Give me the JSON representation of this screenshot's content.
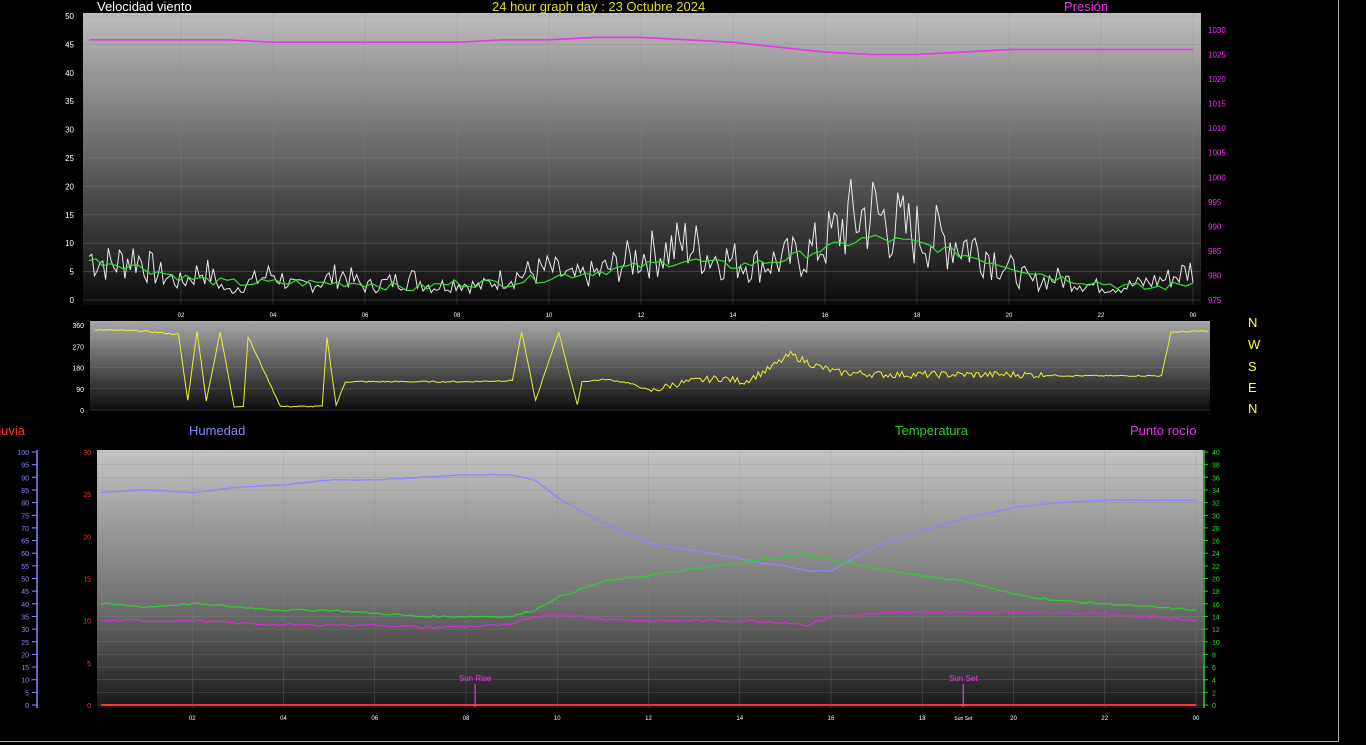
{
  "header": {
    "wind_title": "Velocidad viento",
    "graph_title": "24 hour graph day : 23 Octubre 2024",
    "pressure_title": "Presión"
  },
  "mid_labels": {
    "rain": "Lluvia",
    "humidity": "Humedad",
    "temperature": "Temperatura",
    "dewpoint": "Punto rocío"
  },
  "compass": [
    "N",
    "W",
    "S",
    "E",
    "N"
  ],
  "markers": {
    "sunrise": "Sun Rise",
    "sunset": "Sun Set",
    "sunset_tick": "Sun Set"
  },
  "colors": {
    "wind": "#ffffff",
    "wind_avg": "#33dd33",
    "pressure": "#ee33ee",
    "direction": "#eeee33",
    "humidity": "#8888ff",
    "temperature": "#33cc33",
    "dewpoint": "#cc33cc",
    "rain": "#ff3333"
  },
  "chart_data": [
    {
      "type": "line",
      "id": "wind_pressure",
      "x_ticks": [
        "02",
        "04",
        "06",
        "08",
        "10",
        "12",
        "14",
        "16",
        "18",
        "20",
        "22",
        "00"
      ],
      "y_left_ticks": [
        "0",
        "5",
        "10",
        "15",
        "20",
        "25",
        "30",
        "35",
        "40",
        "45",
        "50"
      ],
      "y_left_range": [
        0,
        50
      ],
      "y_right_ticks": [
        "975",
        "980",
        "985",
        "990",
        "995",
        "1000",
        "1005",
        "1010",
        "1015",
        "1020",
        "1025",
        "1030"
      ],
      "y_right_range": [
        973,
        1035
      ],
      "series": [
        {
          "key": "wind",
          "axis": "left",
          "x": [
            0,
            0.5,
            1,
            1.5,
            2,
            2.5,
            3,
            3.5,
            4,
            4.5,
            5,
            5.5,
            6,
            6.5,
            7,
            7.5,
            8,
            8.5,
            9,
            9.5,
            10,
            10.5,
            11,
            11.5,
            12,
            12.5,
            13,
            13.5,
            14,
            14.5,
            15,
            15.5,
            16,
            16.5,
            17,
            17.5,
            18,
            18.5,
            19,
            19.5,
            20,
            20.5,
            21,
            21.5,
            22,
            22.5,
            23,
            23.5,
            24
          ],
          "y": [
            10,
            8,
            10,
            6,
            4,
            7,
            2,
            4,
            6,
            3,
            4,
            6,
            3,
            4,
            5,
            3,
            4,
            3,
            5,
            6,
            7,
            5,
            6,
            8,
            10,
            11,
            13,
            10,
            9,
            8,
            9,
            10,
            13,
            18,
            20,
            17,
            15,
            14,
            13,
            11,
            7,
            4,
            5,
            4,
            3,
            3,
            4,
            5,
            7
          ]
        },
        {
          "key": "wind_avg",
          "axis": "left",
          "x": [
            0,
            1,
            2,
            3,
            4,
            5,
            6,
            7,
            8,
            9,
            10,
            11,
            12,
            13,
            14,
            15,
            16,
            17,
            18,
            19,
            20,
            21,
            22,
            23,
            24
          ],
          "y": [
            7,
            6,
            4,
            3,
            3,
            3,
            3,
            2,
            3,
            3,
            4,
            5,
            6,
            7,
            6,
            7,
            9,
            11,
            10,
            8,
            6,
            4,
            3,
            2,
            3
          ]
        },
        {
          "key": "pressure",
          "axis": "right",
          "x": [
            0,
            1,
            2,
            3,
            4,
            5,
            6,
            7,
            8,
            9,
            10,
            11,
            12,
            13,
            14,
            15,
            16,
            17,
            18,
            19,
            20,
            21,
            22,
            23,
            24
          ],
          "y": [
            1028,
            1028,
            1028,
            1028,
            1027.5,
            1027.5,
            1027.5,
            1027.5,
            1027.5,
            1028,
            1028,
            1028.5,
            1028.5,
            1028,
            1027.5,
            1026.5,
            1025.5,
            1025,
            1025,
            1025.5,
            1026,
            1026,
            1026,
            1026,
            1026
          ]
        }
      ]
    },
    {
      "type": "line",
      "id": "wind_direction",
      "y_ticks": [
        "0",
        "90",
        "180",
        "270",
        "360"
      ],
      "y_range": [
        0,
        360
      ],
      "series": [
        {
          "key": "direction",
          "x": [
            0,
            1,
            1.8,
            2,
            2.2,
            2.4,
            2.7,
            3,
            3.2,
            3.3,
            4,
            4.9,
            5,
            5.2,
            5.4,
            5.6,
            6,
            7,
            8,
            9,
            9.2,
            9.5,
            10,
            10.4,
            10.5,
            11,
            11.5,
            12,
            12.5,
            13,
            13.5,
            14,
            14.5,
            15,
            15.5,
            16,
            17,
            18,
            19,
            20,
            21,
            22,
            23,
            23.2,
            24
          ],
          "y": [
            340,
            335,
            320,
            40,
            335,
            40,
            330,
            15,
            15,
            310,
            15,
            15,
            310,
            20,
            120,
            120,
            120,
            120,
            120,
            125,
            330,
            40,
            330,
            20,
            120,
            130,
            115,
            80,
            110,
            125,
            135,
            120,
            170,
            235,
            190,
            160,
            150,
            150,
            150,
            150,
            145,
            145,
            145,
            330,
            335
          ]
        }
      ]
    },
    {
      "type": "line",
      "id": "temp_humidity",
      "x_ticks": [
        "02",
        "04",
        "06",
        "08",
        "10",
        "12",
        "14",
        "16",
        "18",
        "20",
        "22",
        "00"
      ],
      "y_humidity_ticks": [
        "0",
        "5",
        "10",
        "15",
        "20",
        "25",
        "30",
        "35",
        "40",
        "45",
        "50",
        "55",
        "60",
        "65",
        "70",
        "75",
        "80",
        "85",
        "90",
        "95",
        "100"
      ],
      "y_humidity_range": [
        0,
        100
      ],
      "y_rain_ticks": [
        "0",
        "5",
        "10",
        "15",
        "20",
        "25",
        "30"
      ],
      "y_rain_range": [
        0,
        30
      ],
      "y_temp_ticks": [
        "0",
        "2",
        "4",
        "6",
        "8",
        "10",
        "12",
        "14",
        "16",
        "18",
        "20",
        "22",
        "24",
        "26",
        "28",
        "30",
        "32",
        "34",
        "36",
        "38",
        "40"
      ],
      "y_temp_range": [
        0,
        40
      ],
      "series": [
        {
          "key": "humidity",
          "axis": "humidity",
          "x": [
            0,
            1,
            2,
            3,
            4,
            5,
            6,
            7,
            8,
            9,
            9.5,
            10,
            11,
            12,
            13,
            14,
            14.5,
            15,
            15.5,
            16,
            16.5,
            17,
            18,
            19,
            20,
            21,
            22,
            23,
            24
          ],
          "y": [
            84,
            85,
            84,
            86,
            87,
            89,
            89,
            90,
            91,
            91,
            89,
            82,
            72,
            64,
            61,
            58,
            56,
            55,
            53,
            53,
            58,
            63,
            69,
            74,
            78,
            80,
            81,
            81,
            81
          ]
        },
        {
          "key": "temperature",
          "axis": "temp",
          "x": [
            0,
            1,
            2,
            3,
            4,
            5,
            6,
            7,
            8,
            9,
            9.5,
            10,
            11,
            12,
            13,
            14,
            15,
            15.5,
            16,
            17,
            18,
            19,
            20,
            21,
            22,
            23,
            24
          ],
          "y": [
            16,
            15.5,
            16,
            15.5,
            15,
            15,
            14.5,
            14,
            14,
            14,
            15,
            17,
            19.5,
            20.5,
            21.5,
            22.5,
            23.5,
            23.7,
            23,
            21.5,
            20.5,
            19.5,
            17.5,
            16.5,
            16,
            15.5,
            15
          ]
        },
        {
          "key": "dewpoint",
          "axis": "rain",
          "x": [
            0,
            1,
            2,
            3,
            4,
            5,
            6,
            7,
            8,
            9,
            9.5,
            10,
            11,
            12,
            13,
            14,
            15,
            15.5,
            16,
            17,
            18,
            19,
            20,
            21,
            22,
            23,
            24
          ],
          "y": [
            10,
            10,
            10,
            9.7,
            9.5,
            9.5,
            9.5,
            9.2,
            9.3,
            9.5,
            10.5,
            10.8,
            10.2,
            10,
            10,
            10,
            9.8,
            9.5,
            10.5,
            10.8,
            11,
            11,
            11,
            11,
            10.8,
            10.5,
            10
          ]
        },
        {
          "key": "rain",
          "axis": "rain",
          "x": [
            0,
            24
          ],
          "y": [
            0,
            0
          ]
        }
      ],
      "sunrise_hour": 8.2,
      "sunset_hour": 18.9
    }
  ]
}
